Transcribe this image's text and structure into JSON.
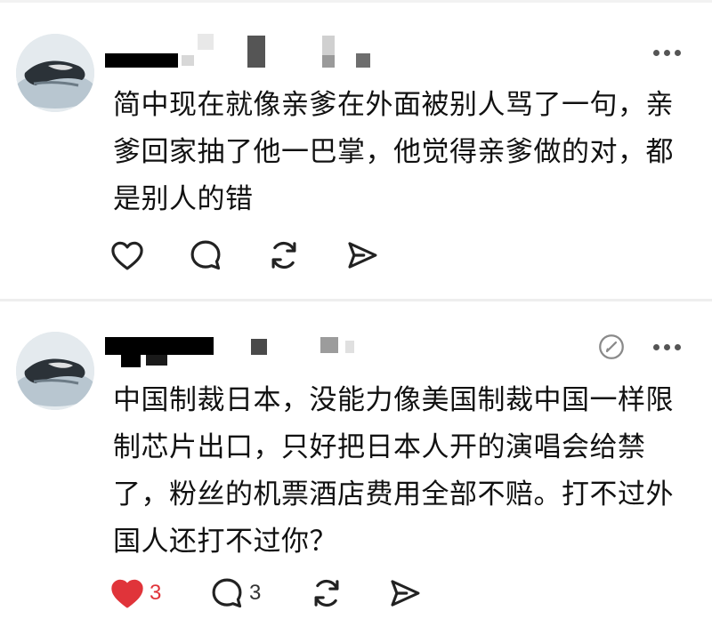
{
  "posts": [
    {
      "text": "简中现在就像亲爹在外面被别人骂了一句，亲爹回家抽了他一巴掌，他觉得亲爹做的对，都是别人的错",
      "liked": false,
      "like_count": "",
      "reply_count": ""
    },
    {
      "text": "中国制裁日本，没能力像美国制裁中国一样限制芯片出口，只好把日本人开的演唱会给禁了，粉丝的机票酒店费用全部不赔。打不过外国人还打不过你？",
      "liked": true,
      "like_count": "3",
      "reply_count": "3"
    }
  ],
  "icons": {
    "like": "heart-icon",
    "reply": "comment-bubble-icon",
    "repost": "repost-icon",
    "share": "send-icon",
    "more": "more-dots-icon",
    "edit": "edited-icon"
  },
  "colors": {
    "like_active": "#e0343a",
    "icon": "#222222",
    "text": "#111111"
  }
}
